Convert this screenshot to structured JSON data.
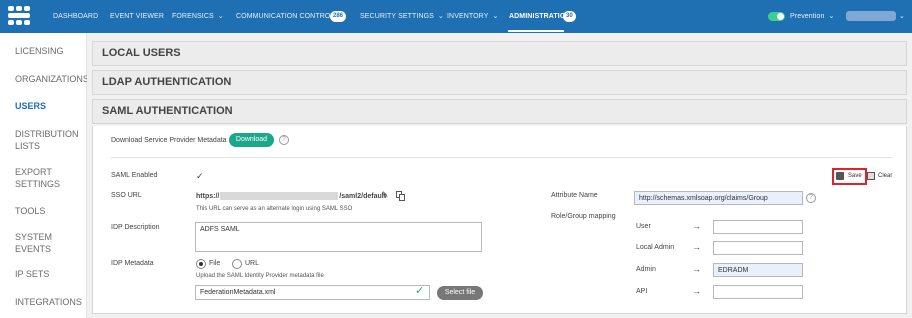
{
  "topnav": {
    "items": [
      "DASHBOARD",
      "EVENT VIEWER",
      "FORENSICS",
      "COMMUNICATION CONTROL",
      "SECURITY SETTINGS",
      "INVENTORY",
      "ADMINISTRATION"
    ],
    "badges": {
      "communication_control": "286",
      "administration": "30"
    },
    "mode_label": "Prevention",
    "accent_color": "#1f6fb3"
  },
  "sidebar": {
    "items": [
      "LICENSING",
      "ORGANIZATIONS",
      "USERS",
      "DISTRIBUTION",
      "LISTS",
      "EXPORT",
      "SETTINGS",
      "TOOLS",
      "SYSTEM",
      "EVENTS",
      "IP SETS",
      "INTEGRATIONS"
    ]
  },
  "panels": {
    "local_users": "LOCAL USERS",
    "ldap": "LDAP AUTHENTICATION",
    "saml": "SAML AUTHENTICATION"
  },
  "saml": {
    "download_label": "Download Service Provider Metadata",
    "download_button": "Download",
    "saml_enabled_label": "SAML Enabled",
    "saml_enabled_value": "✓",
    "sso_url_label": "SSO URL",
    "sso_url_prefix": "https://",
    "sso_url_suffix_a": "/saml2/",
    "sso_url_suffix_b": "default",
    "sso_url_note": "This URL can serve as an alternate login using SAML SSO",
    "idp_description_label": "IDP Description",
    "idp_description_value": "ADFS SAML",
    "idp_metadata_label": "IDP Metadata",
    "radio_file": "File",
    "radio_url": "URL",
    "upload_note": "Upload the SAML Identity Provider metadata file",
    "metadata_file_value": "FederationMetadata.xml",
    "select_file_button": "Select file",
    "attribute_name_label": "Attribute Name",
    "attribute_name_value": "http://schemas.xmlsoap.org/claims/Group",
    "role_mapping_label": "Role/Group mapping",
    "roles": [
      {
        "label": "User",
        "value": ""
      },
      {
        "label": "Local Admin",
        "value": ""
      },
      {
        "label": "Admin",
        "value": "EDRADM"
      },
      {
        "label": "API",
        "value": ""
      }
    ],
    "save_label": "Save",
    "clear_label": "Clear"
  }
}
